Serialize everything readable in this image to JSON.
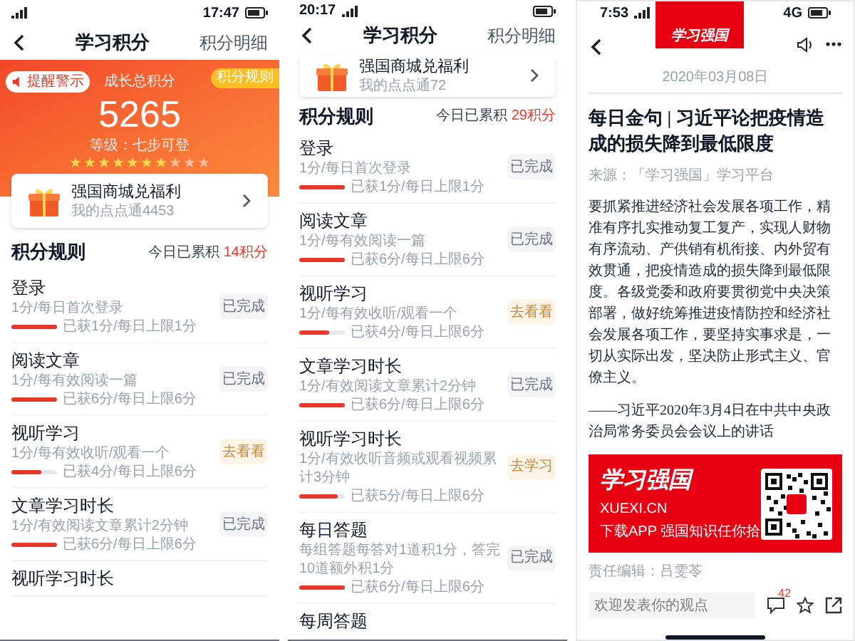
{
  "panels": [
    {
      "kind": "points",
      "status": {
        "right": "17:47"
      },
      "nav": {
        "title": "学习积分",
        "link": "积分明细"
      },
      "header": {
        "badge": "提醒警示",
        "label": "成长总积分",
        "total": "5265",
        "level_text": "等级：七步可登",
        "stars": 7,
        "rules_link": "积分规则"
      },
      "mall": {
        "title": "强国商城兑福利",
        "subtitle": "我的点点通4453"
      },
      "rules_title": "积分规则",
      "today_label": "今日已累积",
      "today_value": "14积分",
      "rules": [
        {
          "title": "登录",
          "desc": "1分/每日首次登录",
          "progress": "已获1分/每日上限1分",
          "level": 1,
          "button": "已完成",
          "done": true
        },
        {
          "title": "阅读文章",
          "desc": "1分/每有效阅读一篇",
          "progress": "已获6分/每日上限6分",
          "level": 1,
          "button": "已完成",
          "done": true
        },
        {
          "title": "视听学习",
          "desc": "1分/每有效收听/观看一个",
          "progress": "已获4分/每日上限6分",
          "level": 0.67,
          "button": "去看看",
          "done": false
        },
        {
          "title": "文章学习时长",
          "desc": "1分/有效阅读文章累计2分钟",
          "progress": "已获6分/每日上限6分",
          "level": 1,
          "button": "已完成",
          "done": true
        },
        {
          "title": "视听学习时长"
        }
      ]
    },
    {
      "kind": "points",
      "status": {
        "left": "20:17"
      },
      "nav": {
        "title": "学习积分",
        "link": "积分明细"
      },
      "mall": {
        "title": "强国商城兑福利",
        "subtitle": "我的点点通72"
      },
      "rules_title": "积分规则",
      "today_label": "今日已累积",
      "today_value": "29积分",
      "rules": [
        {
          "title": "登录",
          "desc": "1分/每日首次登录",
          "progress": "已获1分/每日上限1分",
          "level": 1,
          "button": "已完成",
          "done": true
        },
        {
          "title": "阅读文章",
          "desc": "1分/每有效阅读一篇",
          "progress": "已获6分/每日上限6分",
          "level": 1,
          "button": "已完成",
          "done": true
        },
        {
          "title": "视听学习",
          "desc": "1分/每有效收听/观看一个",
          "progress": "已获4分/每日上限6分",
          "level": 0.67,
          "button": "去看看",
          "done": false
        },
        {
          "title": "文章学习时长",
          "desc": "1分/有效阅读文章累计2分钟",
          "progress": "已获6分/每日上限6分",
          "level": 1,
          "button": "已完成",
          "done": true
        },
        {
          "title": "视听学习时长",
          "desc": "1分/有效收听音频或观看视频累计3分钟",
          "progress": "已获5分/每日上限6分",
          "level": 0.83,
          "button": "去学习",
          "done": false
        },
        {
          "title": "每日答题",
          "desc": "每组答题每答对1道积1分，答完10道额外积1分",
          "progress": "已获6分/每日上限6分",
          "level": 1,
          "button": "已完成",
          "done": true
        },
        {
          "title": "每周答题"
        }
      ]
    },
    {
      "kind": "article",
      "status": {
        "left": "7:53",
        "right": "4G"
      },
      "logo_text": "学习强国",
      "date": "2020年03月08日",
      "title": "每日金句 | 习近平论把疫情造成的损失降到最低限度",
      "source": "来源：「学习强国」学习平台",
      "body": "要抓紧推进经济社会发展各项工作，精准有序扎实推动复工复产，实现人财物有序流动、产供销有机衔接、内外贸有效贯通，把疫情造成的损失降到最低限度。各级党委和政府要贯彻党中央决策部署，做好统筹推进疫情防控和经济社会发展各项工作，要坚持实事求是，一切从实际出发，坚决防止形式主义、官僚主义。",
      "quote": "——习近平2020年3月4日在中共中央政治局常务委员会会议上的讲话",
      "banner": {
        "brand": "学习强国",
        "domain": "XUEXI.CN",
        "tagline": "下载APP 强国知识任你拾"
      },
      "editor": "责任编辑：吕雯苓",
      "comment_placeholder": "欢迎发表你的观点",
      "comment_count": "42"
    }
  ]
}
